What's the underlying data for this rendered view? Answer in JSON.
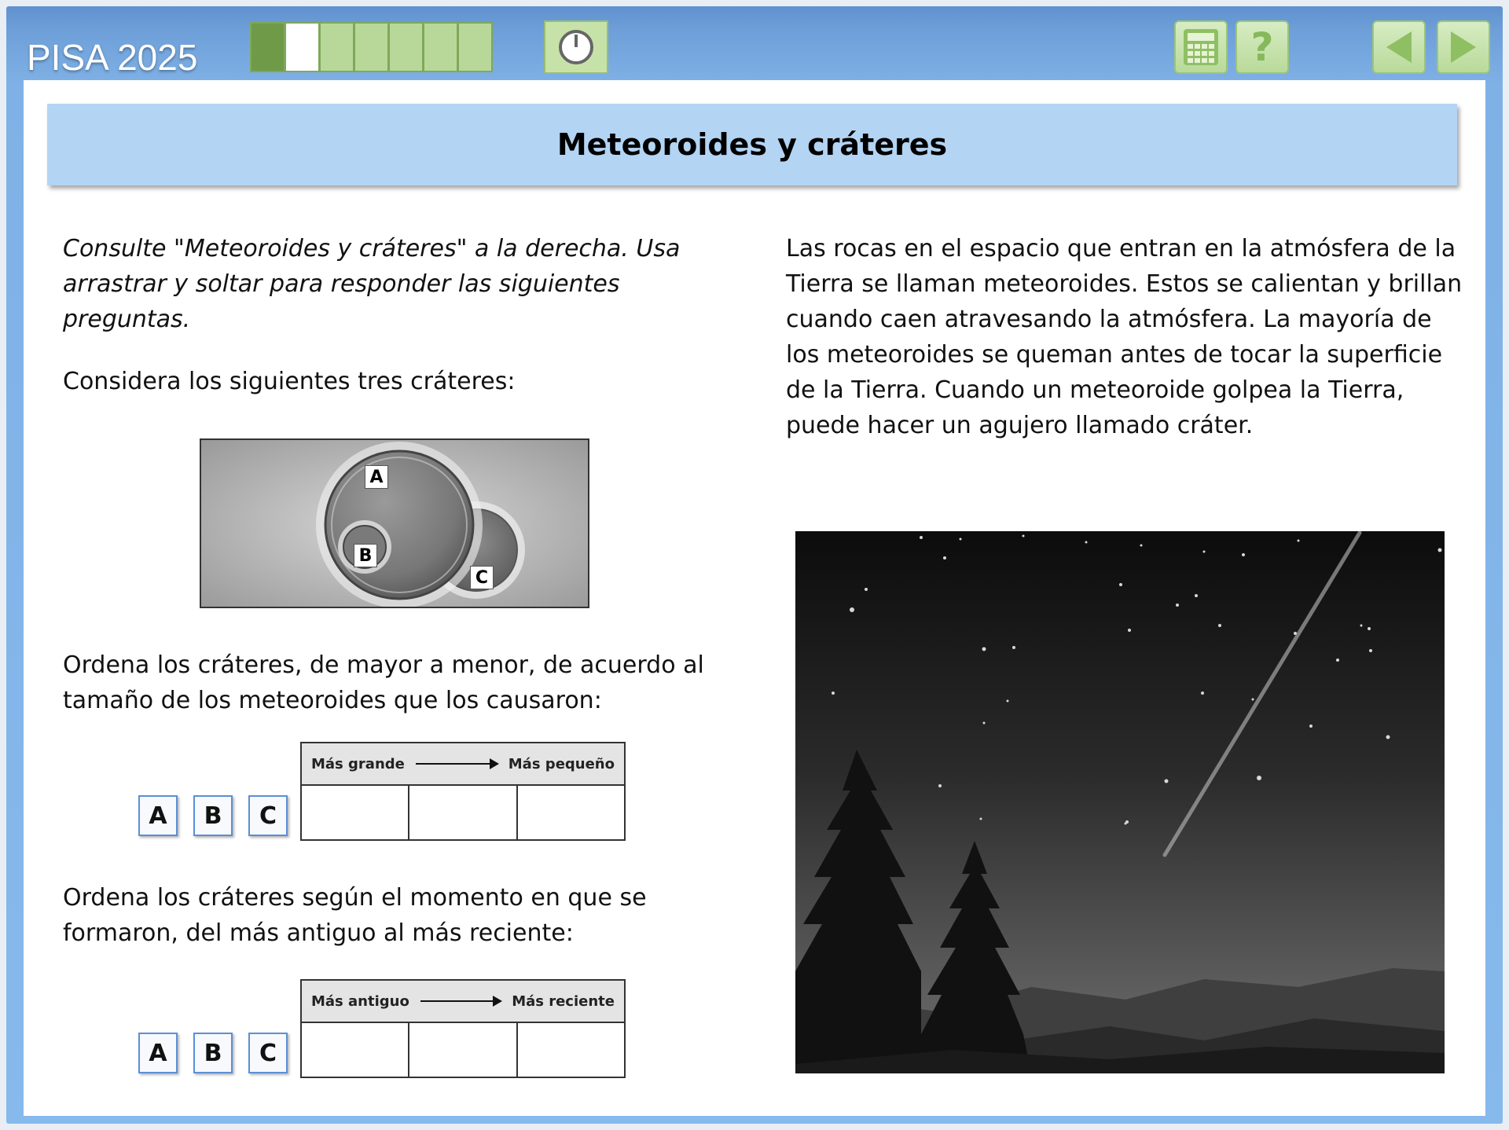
{
  "app": {
    "brand": "PISA 2025"
  },
  "progress": {
    "total_segments": 7,
    "completed": 1,
    "current": 2
  },
  "toolbar": {
    "timer_icon": "timer-icon",
    "calculator_icon": "calculator-icon",
    "help_icon": "help-icon",
    "back_icon": "arrow-left-icon",
    "next_icon": "arrow-right-icon",
    "help_glyph": "?"
  },
  "title": "Meteoroides y cráteres",
  "instructions": "Consulte \"Meteoroides y cráteres\" a la derecha. Usa arrastrar y soltar para responder las siguientes preguntas.",
  "consider_text": "Considera los siguientes tres cráteres:",
  "crater_labels": {
    "a": "A",
    "b": "B",
    "c": "C"
  },
  "question1": {
    "text": "Ordena los cráteres, de mayor a menor, de acuerdo al tamaño de los meteoroides que los causaron:",
    "head_left": "Más grande",
    "head_right": "Más pequeño",
    "tiles": [
      "A",
      "B",
      "C"
    ]
  },
  "question2": {
    "text": "Ordena los cráteres según el momento en que se formaron, del más antiguo al más reciente:",
    "head_left": "Más antiguo",
    "head_right": "Más reciente",
    "tiles": [
      "A",
      "B",
      "C"
    ]
  },
  "stimulus": "Las rocas en el espacio que entran en la atmósfera de la Tierra se llaman meteoroides. Estos se calientan y brillan cuando caen atravesando la atmósfera. La mayoría de los meteoroides se queman antes de tocar la superficie de la Tierra. Cuando un meteoroide golpea la Tierra, puede hacer un agujero llamado cráter.",
  "colors": {
    "frame": "#6e9fd8",
    "title_bg": "#b3d4f3",
    "tile_border": "#5b8fd6",
    "tool_green": "#b9da9a"
  }
}
